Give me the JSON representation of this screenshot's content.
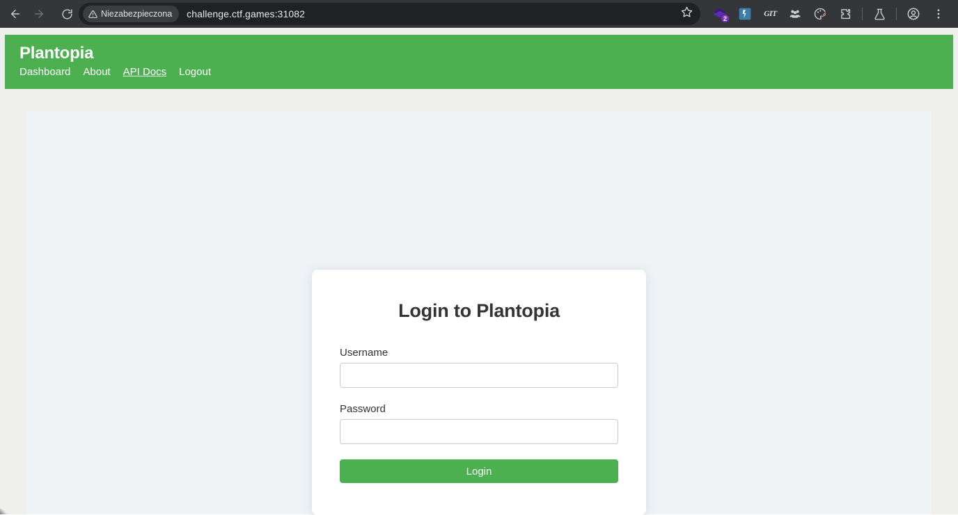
{
  "browser": {
    "back_icon": "arrow-left-icon",
    "forward_icon": "arrow-right-icon",
    "reload_icon": "reload-icon",
    "security_label": "Niezabezpieczona",
    "security_icon": "warning-triangle-icon",
    "url": "challenge.ctf.games:31082",
    "bookmark_icon": "star-icon",
    "extensions": [
      {
        "name": "layers-extension-icon",
        "badge": "2"
      },
      {
        "name": "blue-tool-extension-icon",
        "badge": ""
      },
      {
        "name": "git-extension-icon",
        "label": "GIT"
      },
      {
        "name": "people-group-extension-icon",
        "badge": ""
      },
      {
        "name": "palette-pencil-extension-icon",
        "badge": ""
      },
      {
        "name": "puzzle-extensions-icon",
        "badge": ""
      },
      {
        "name": "flask-labs-icon",
        "badge": ""
      }
    ],
    "profile_icon": "account-circle-icon",
    "menu_icon": "three-dot-menu-icon"
  },
  "site": {
    "brand": "Plantopia",
    "nav": [
      {
        "label": "Dashboard",
        "active": false
      },
      {
        "label": "About",
        "active": false
      },
      {
        "label": "API Docs",
        "active": true
      },
      {
        "label": "Logout",
        "active": false
      }
    ]
  },
  "login": {
    "title": "Login to Plantopia",
    "username_label": "Username",
    "username_value": "",
    "username_placeholder": "",
    "password_label": "Password",
    "password_value": "",
    "password_placeholder": "",
    "submit_label": "Login"
  },
  "colors": {
    "brand_green": "#4CAF50",
    "chrome_bg": "#35363A",
    "omnibox_bg": "#202124",
    "page_bg": "#EFEFEE",
    "content_bg": "#EFF3F6",
    "card_bg": "#FFFFFF",
    "text_dark": "#333333",
    "input_border": "#CCCCCC"
  }
}
